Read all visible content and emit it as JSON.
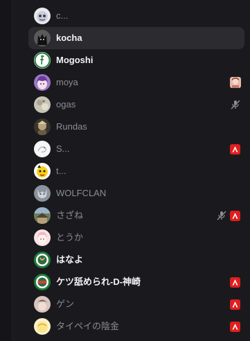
{
  "members": [
    {
      "name": "c..."
    },
    {
      "name": "kocha"
    },
    {
      "name": "Mogoshi"
    },
    {
      "name": "moya"
    },
    {
      "name": "ogas"
    },
    {
      "name": "Rundas"
    },
    {
      "name": "S..."
    },
    {
      "name": "t..."
    },
    {
      "name": "WOLFCLAN"
    },
    {
      "name": "さざね"
    },
    {
      "name": "とうか"
    },
    {
      "name": "はなよ"
    },
    {
      "name": "ケツ舐められ-D-神崎"
    },
    {
      "name": "ゲン"
    },
    {
      "name": "タイペイの陰金"
    }
  ],
  "colors": {
    "background": "#1a1a1e",
    "hover_row": "#2b2b30",
    "name_dim": "#8b8d94",
    "name_bright": "#f2f3f5",
    "app_badge": "#e01e1e"
  },
  "icons": {
    "app_badge": "red-triangle-app-icon",
    "muted": "mic-muted-icon",
    "game_activity": "game-activity-icon"
  }
}
